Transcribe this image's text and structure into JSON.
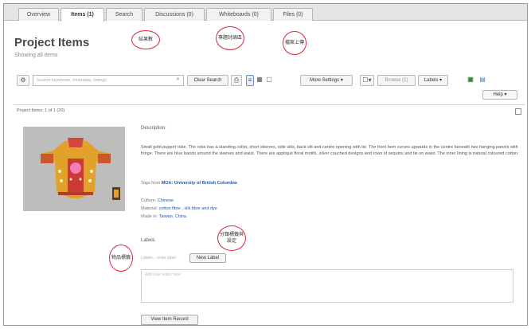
{
  "tabs": [
    {
      "label": "Overview"
    },
    {
      "label": "Items (1)"
    },
    {
      "label": "Search"
    },
    {
      "label": "Discussions (0)"
    },
    {
      "label": "Whiteboards (0)"
    },
    {
      "label": "Files (0)"
    }
  ],
  "header": {
    "title": "Project Items",
    "subtitle": "Showing all items"
  },
  "toolbar": {
    "search_placeholder": "Search keywords, metadata, listings",
    "clear_search": "Clear Search",
    "more_settings": "More Settings ▾",
    "browse": "Browse (1)",
    "labels": "Labels ▾"
  },
  "help": "Help ▾",
  "results": {
    "count_text": "Project Items: 1 of 1 (20)"
  },
  "item": {
    "description_label": "Description:",
    "description_text": "Small gold puppet robe. The robe has a standing collar, short sleeves, side slits, back slit and centre opening with tie. The front hem curves upwards in the centre beneath two hanging panels with fringe. There are blue bands around the sleeves and waist. There are appliqué floral motifs, silver couched designs and rows of sequins and tie on waist. The inner lining is natural coloured cotton.",
    "tags_prefix": "Tags from",
    "tags_source": "MOA: University of British Columbia",
    "culture_label": "Culture:",
    "culture_value": "Chinese",
    "material_label": "Material:",
    "material_value": "cotton fibre , silk fibre and dye",
    "made_in_label": "Made in:",
    "made_in_value": "Taiwan, China",
    "labels_heading": "Labels",
    "labels_placeholder": "Labels... enter label",
    "new_label_button": "New Label",
    "notes_placeholder": "Add your notes here",
    "view_record_button": "View Item Record"
  },
  "annotations": {
    "n1": "結果數",
    "n2": "專題討論區",
    "n3": "檔案上傳",
    "n4": "物品標籤",
    "n5": "分類標籤與設定"
  },
  "colors": {
    "accent_link": "#2a57a7",
    "annotation_red": "#d8263b"
  }
}
